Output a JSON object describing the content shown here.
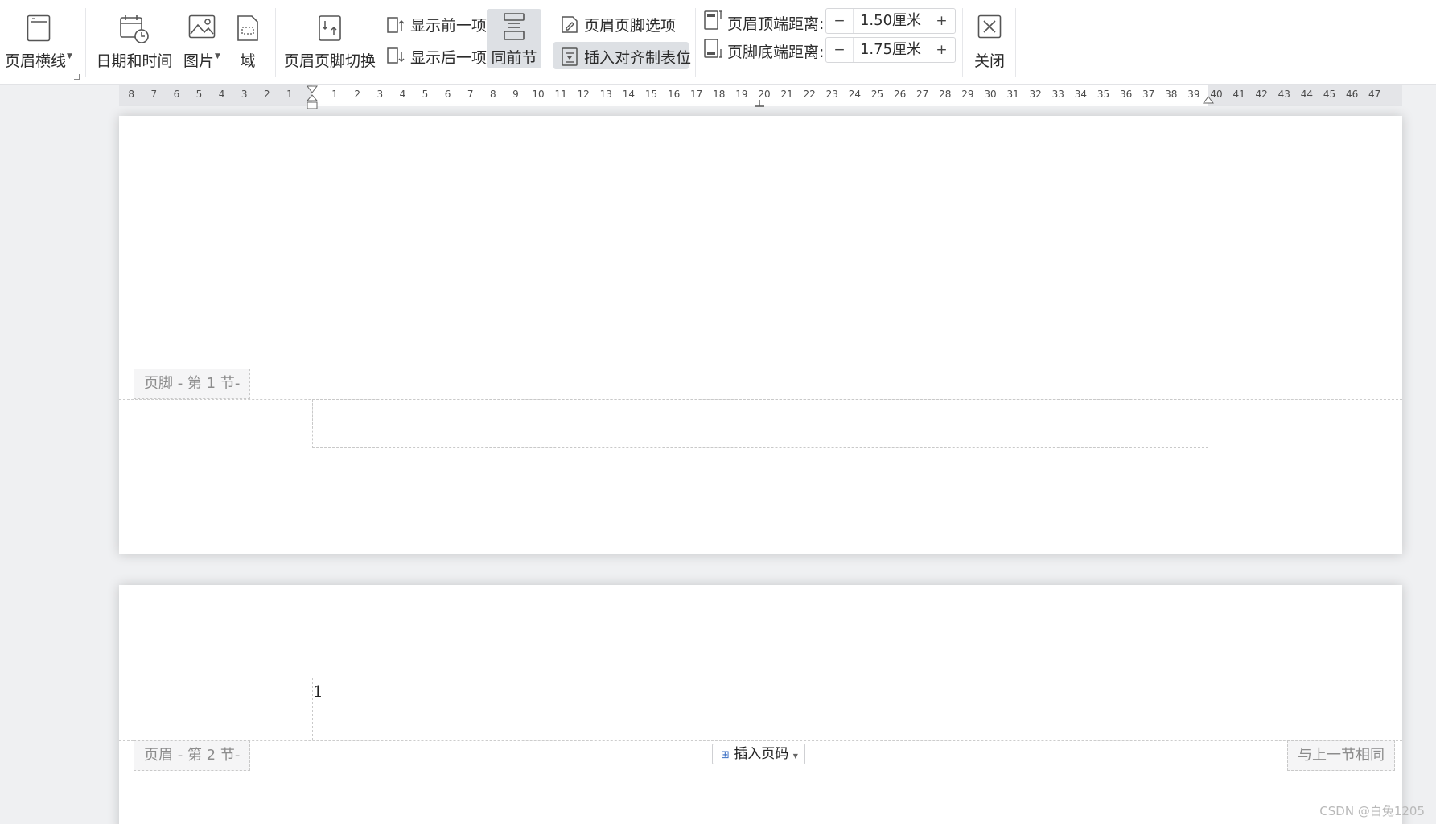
{
  "ribbon": {
    "header_line": "页眉横线",
    "date_time": "日期和时间",
    "picture": "图片",
    "field": "域",
    "switch_header_footer": "页眉页脚切换",
    "show_previous": "显示前一项",
    "show_next": "显示后一项",
    "same_as_previous": "同前节",
    "header_footer_options": "页眉页脚选项",
    "insert_align_tab": "插入对齐制表位",
    "header_top_label": "页眉顶端距离:",
    "header_top_value": "1.50厘米",
    "footer_bottom_label": "页脚底端距离:",
    "footer_bottom_value": "1.75厘米",
    "minus": "−",
    "plus": "+",
    "close": "关闭"
  },
  "ruler": {
    "left_ticks": [
      "8",
      "7",
      "6",
      "5",
      "4",
      "3",
      "2",
      "1"
    ],
    "right_ticks": [
      "1",
      "2",
      "3",
      "4",
      "5",
      "6",
      "7",
      "8",
      "9",
      "10",
      "11",
      "12",
      "13",
      "14",
      "15",
      "16",
      "17",
      "18",
      "19",
      "20",
      "21",
      "22",
      "23",
      "24",
      "25",
      "26",
      "27",
      "28",
      "29",
      "30",
      "31",
      "32",
      "33",
      "34",
      "35",
      "36",
      "37",
      "38",
      "39",
      "40",
      "41",
      "42",
      "43",
      "44",
      "45",
      "46",
      "47"
    ]
  },
  "page1": {
    "footer_tag": "页脚  - 第 1 节-"
  },
  "page2": {
    "header_content": "1",
    "header_tag": "页眉  - 第 2 节-",
    "insert_page_number": "插入页码",
    "same_as_previous_tag": "与上一节相同"
  },
  "watermark": "CSDN @白兔1205",
  "colors": {
    "ribbon_bg": "#ffffff",
    "workspace_bg": "#eff0f2",
    "active_button": "#dde0e4",
    "dashed_border": "#c9c9c9",
    "tag_text": "#8c8c8c"
  },
  "icons": {
    "header_line": "header-line-icon",
    "date_time": "calendar-clock-icon",
    "picture": "picture-icon",
    "field": "field-icon",
    "switch": "switch-header-footer-icon",
    "prev": "show-previous-icon",
    "next": "show-next-icon",
    "same_prev": "same-as-previous-icon",
    "options": "options-icon",
    "align_tab": "align-tab-icon",
    "header_top": "header-top-distance-icon",
    "footer_bottom": "footer-bottom-distance-icon",
    "close": "close-icon"
  }
}
